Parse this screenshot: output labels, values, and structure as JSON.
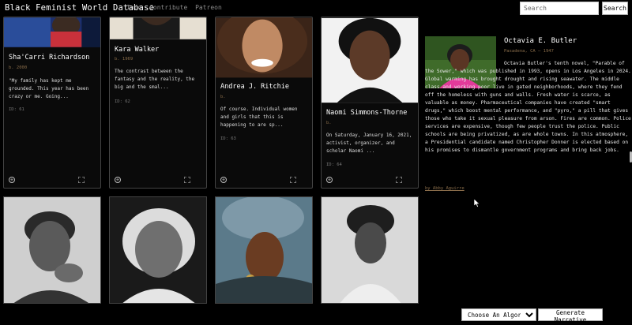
{
  "header": {
    "brand": "Black Feminist World Database",
    "nav": [
      "Info",
      "Contribute",
      "Patreon"
    ],
    "search_placeholder": "Search",
    "search_button": "Search"
  },
  "cards": [
    {
      "name": "Sha'Carri Richardson",
      "born": "b. 2000",
      "excerpt": "\"My family has kept me grounded. This year has been crazy or me. Going...",
      "id": "ID: 61"
    },
    {
      "name": "Kara Walker",
      "born": "b. 1969",
      "excerpt": "The contrast between the fantasy and the reality, the big and the smal...",
      "id": "ID: 62"
    },
    {
      "name": "Andrea J. Ritchie",
      "born": "b.",
      "excerpt": "Of course. Individual women and girls that this is happening to are sp...",
      "id": "ID: 63"
    },
    {
      "name": "Naomi Simmons-Thorne",
      "born": "b.",
      "excerpt": "On Saturday, January 16, 2021, activist, organizer, and scholar Naomi ...",
      "id": "ID: 64"
    }
  ],
  "detail": {
    "name": "Octavia E. Butler",
    "location": "Pasadena, CA — 1947",
    "text": "Octavia Butler's tenth novel, \"Parable of the Sower,\" which was published in 1993, opens in Los Angeles in 2024. Global warming has brought drought and rising seawater. The middle class and working poor live in gated neighborhoods, where they fend off the homeless with guns and walls. Fresh water is scarce, as valuable as money. Pharmaceutical companies have created \"smart drugs,\" which boost mental performance, and \"pyro,\" a pill that gives those who take it sexual pleasure from arson. Fires are common. Police services are expensive, though few people trust the police. Public schools are being privatized, as are whole towns. In this atmosphere, a Presidential candidate named Christopher Donner is elected based on his promises to dismantle government programs and bring back jobs.",
    "author": "by Abby Aguirre"
  },
  "footer": {
    "algorithm_selected": "Choose An Algorithm",
    "generate_button": "Generate Narrative"
  },
  "icons": {
    "add": "plus-circle-icon",
    "expand": "expand-icon",
    "cursor": "mouse-pointer-icon"
  },
  "colors": {
    "background": "#000000",
    "accent": "#8a6d4a",
    "detail_bg": "#e33a9a"
  }
}
